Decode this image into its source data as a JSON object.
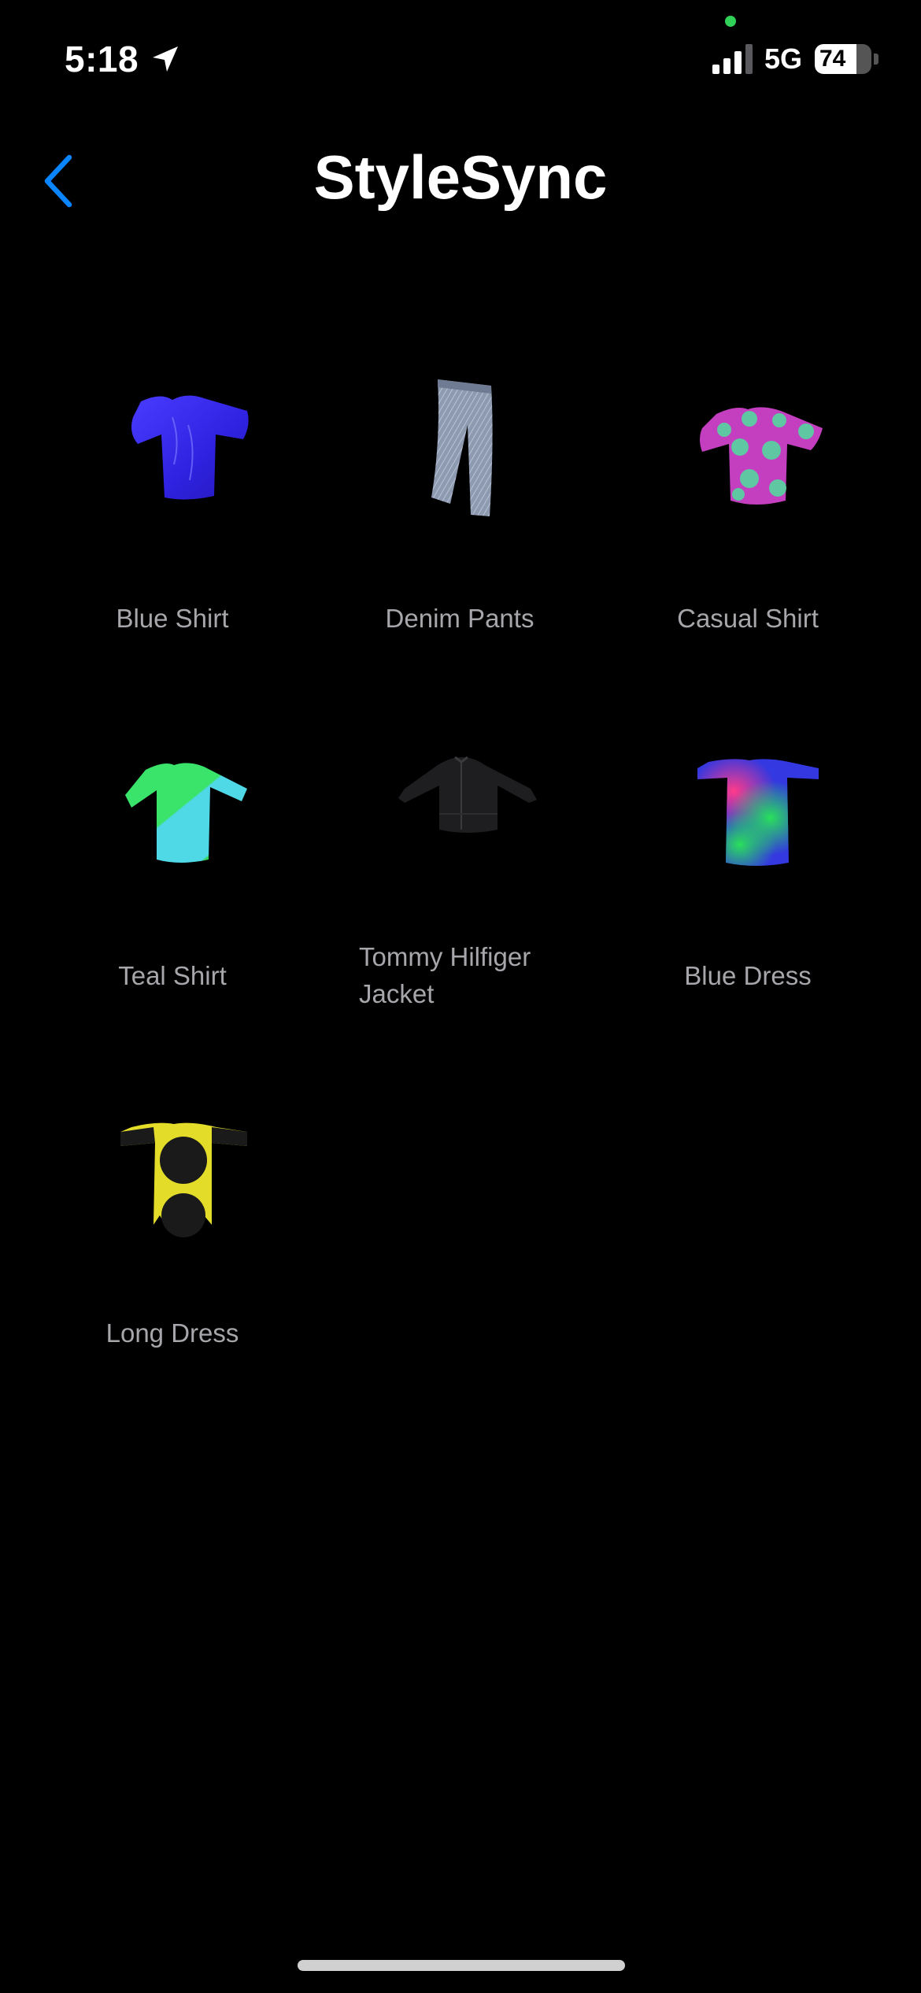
{
  "status_bar": {
    "time": "5:18",
    "network": "5G",
    "battery_level": "74",
    "battery_fraction": 0.74,
    "signal_bars": 3,
    "signal_bars_total": 4,
    "location_icon": "location-arrow-icon",
    "privacy_dot_color": "#30d158"
  },
  "nav": {
    "title": "StyleSync",
    "back_icon": "chevron-left-icon",
    "accent_color": "#0a84ff"
  },
  "items": [
    {
      "label": "Blue Shirt",
      "icon": "blue-shirt-icon"
    },
    {
      "label": "Denim Pants",
      "icon": "denim-pants-icon"
    },
    {
      "label": "Casual Shirt",
      "icon": "casual-shirt-icon"
    },
    {
      "label": "Teal Shirt",
      "icon": "teal-shirt-icon"
    },
    {
      "label": "Tommy Hilfiger Jacket",
      "icon": "jacket-icon"
    },
    {
      "label": "Blue Dress",
      "icon": "blue-dress-icon"
    },
    {
      "label": "Long Dress",
      "icon": "long-dress-icon"
    }
  ]
}
